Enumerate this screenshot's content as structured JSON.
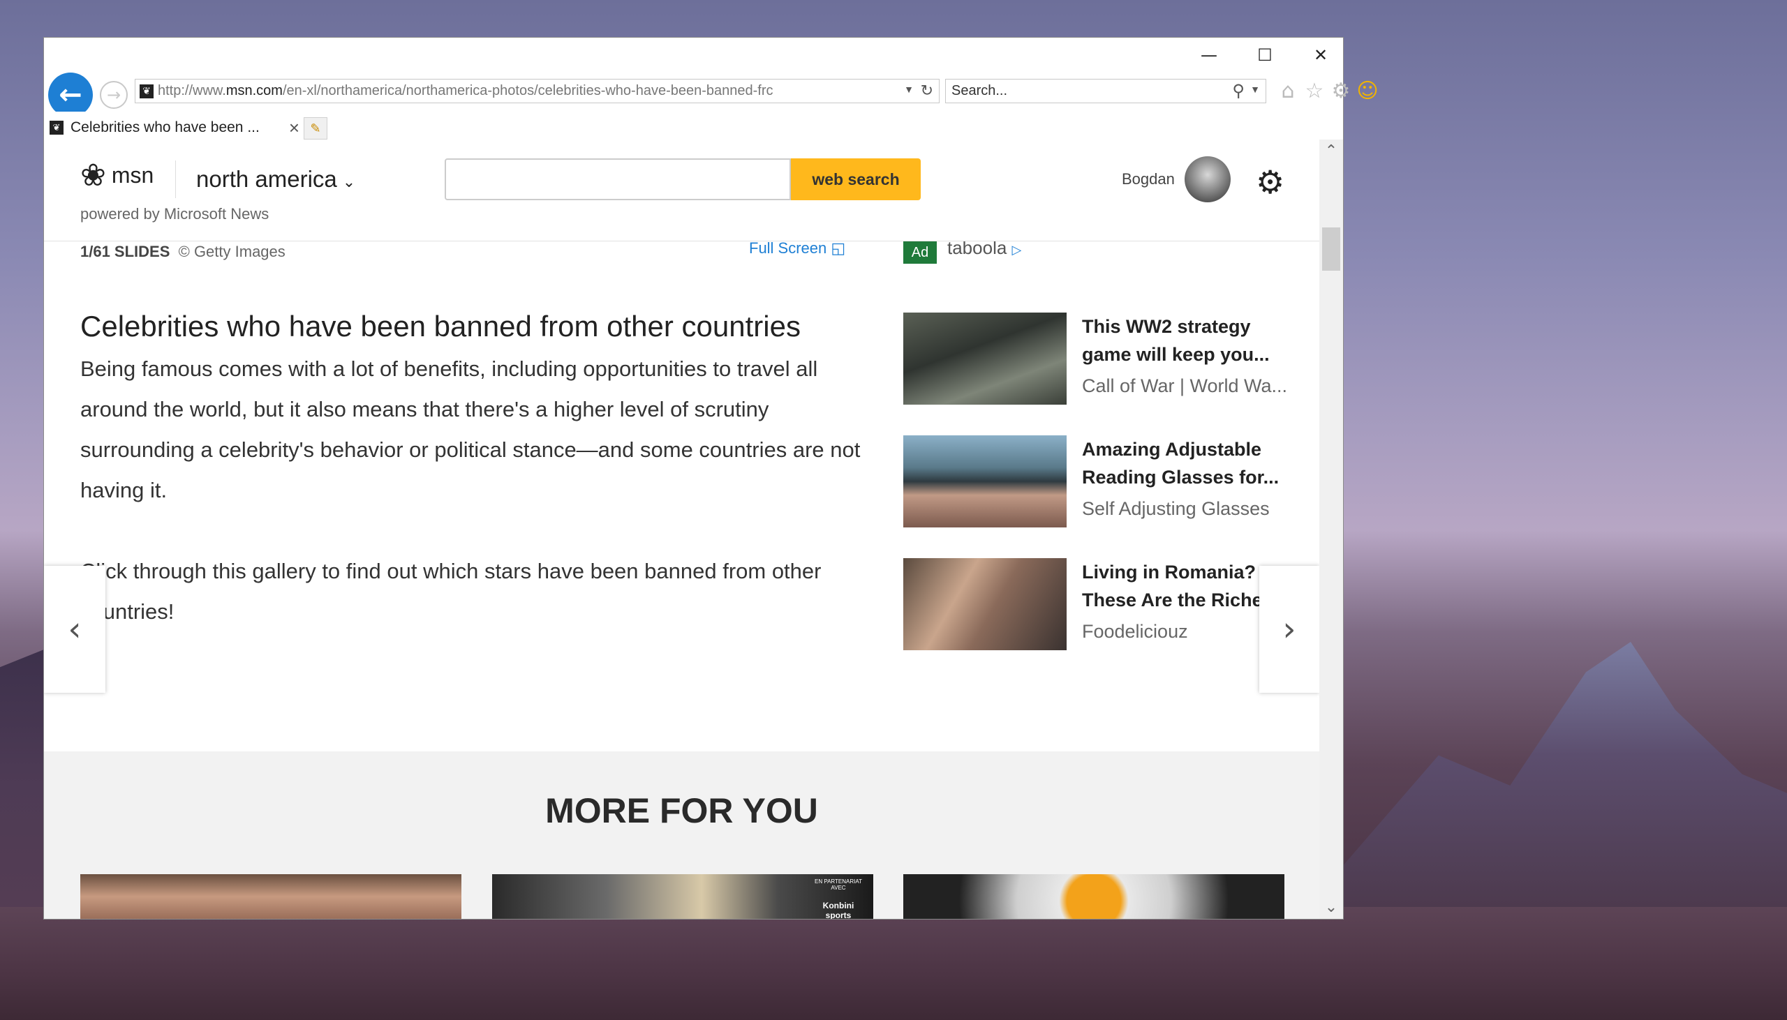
{
  "window": {
    "minimize": "—",
    "maximize": "☐",
    "close": "✕"
  },
  "navbar": {
    "address_prefix": "http://www.",
    "address_domain": "msn.com",
    "address_rest": "/en-xl/northamerica/northamerica-photos/celebrities-who-have-been-banned-frc",
    "search_placeholder": "Search..."
  },
  "tab": {
    "title": "Celebrities who have been ..."
  },
  "msn": {
    "logo_text": "msn",
    "region": "north america",
    "powered_by": "powered by Microsoft News",
    "search_button": "web search",
    "user_name": "Bogdan"
  },
  "slide": {
    "counter": "1/61 SLIDES",
    "credit": "© Getty Images",
    "fullscreen": "Full Screen",
    "headline": "Celebrities who have been banned from other countries",
    "paragraphs": [
      "Being famous comes with a lot of benefits, including opportunities to travel all around the world, but it also means that there's a higher level of scrutiny surrounding a celebrity's behavior or political stance—and some countries are not having it.",
      "Click through this gallery to find out which stars have been banned from other countries!"
    ]
  },
  "ads": {
    "badge": "Ad",
    "provider": "taboola",
    "items": [
      {
        "title_line1": "This WW2 strategy",
        "title_line2": "game will keep you...",
        "source": "Call of War | World Wa..."
      },
      {
        "title_line1": "Amazing Adjustable",
        "title_line2": "Reading Glasses for...",
        "source": "Self Adjusting Glasses"
      },
      {
        "title_line1": "Living in Romania?",
        "title_line2": "These Are the Richest...",
        "source": "Foodeliciouz"
      }
    ]
  },
  "more": {
    "title": "MORE FOR YOU",
    "card2_badge_line1": "EN PARTENARIAT AVEC",
    "card2_badge_line2": "Konbini sports"
  },
  "icons": {
    "back": "back-arrow-icon",
    "forward": "forward-arrow-icon",
    "refresh": "refresh-icon",
    "search": "search-icon",
    "home": "home-icon",
    "favorites": "star-icon",
    "tools": "gear-icon",
    "feedback": "smiley-icon",
    "settings": "settings-gear-icon",
    "prev": "chevron-left-icon",
    "next": "chevron-right-icon"
  },
  "colors": {
    "accent_blue": "#1e7fd4",
    "search_button": "#ffb81c",
    "ad_badge": "#1f7a3a"
  }
}
